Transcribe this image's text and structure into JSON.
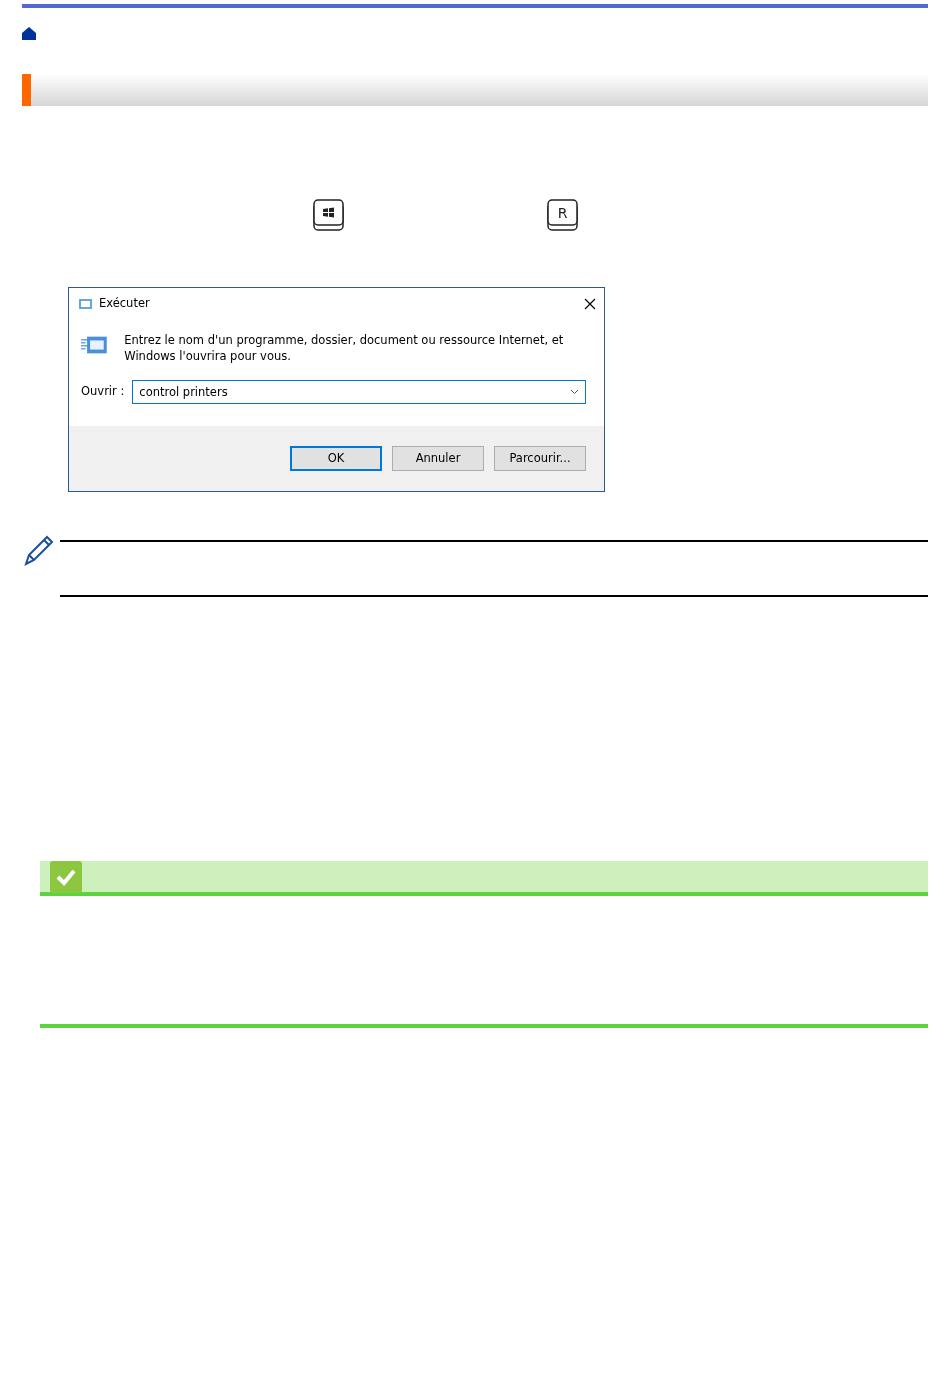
{
  "keys": [
    {
      "kind": "windows"
    },
    {
      "kind": "letter",
      "label": "R"
    }
  ],
  "dialog": {
    "title": "Exécuter",
    "message": "Entrez le nom d'un programme, dossier, document ou ressource Internet, et Windows l'ouvrira pour vous.",
    "open_label": "Ouvrir :",
    "value": "control printers",
    "buttons": [
      {
        "label": "OK",
        "selected": true
      },
      {
        "label": "Annuler",
        "selected": false
      },
      {
        "label": "Parcourir...",
        "selected": false
      }
    ]
  }
}
